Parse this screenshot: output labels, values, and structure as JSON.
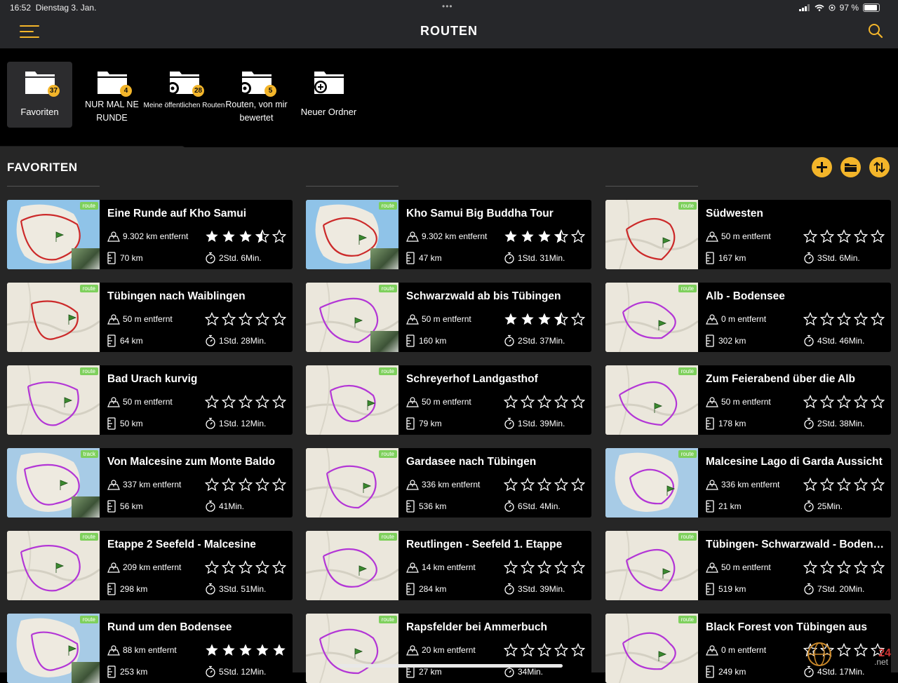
{
  "status_bar": {
    "time": "16:52",
    "date": "Dienstag 3. Jan.",
    "dots": "•••",
    "battery": "97 %"
  },
  "nav": {
    "title": "ROUTEN",
    "menu_icon": "hamburger-menu-icon",
    "search_icon": "search-icon"
  },
  "folders": [
    {
      "label": "Favoriten",
      "badge": "37",
      "icon": "folder-icon",
      "active": true
    },
    {
      "label": "NUR MAL NE RUNDE",
      "badge": "4",
      "icon": "folder-icon"
    },
    {
      "label": "Meine öffentlichen Routen",
      "badge": "28",
      "icon": "folder-gear-icon"
    },
    {
      "label": "Routen, von mir bewertet",
      "badge": "5",
      "icon": "folder-gear-icon"
    },
    {
      "label": "Neuer Ordner",
      "badge": "",
      "icon": "folder-add-icon"
    }
  ],
  "section": {
    "title": "FAVORITEN",
    "add_icon": "add-icon",
    "folder_icon": "folder-icon",
    "sort_icon": "sort-icon"
  },
  "colors": {
    "accent": "#f3b52a",
    "route_line": "#cc2a2a",
    "route_purple": "#b336d6",
    "tag_green": "#7ed05c"
  },
  "routes": [
    {
      "title": "Eine Runde auf Kho Samui",
      "distance": "9.302 km entfernt",
      "length": "70 km",
      "duration": "2Std. 6Min.",
      "rating": 3.5,
      "tag": "route"
    },
    {
      "title": "Kho Samui Big Buddha Tour",
      "distance": "9.302 km entfernt",
      "length": "47 km",
      "duration": "1Std. 31Min.",
      "rating": 3.5,
      "tag": "route"
    },
    {
      "title": "Südwesten",
      "distance": "50 m entfernt",
      "length": "167 km",
      "duration": "3Std. 6Min.",
      "rating": 0,
      "tag": "route"
    },
    {
      "title": "Tübingen nach Waiblingen",
      "distance": "50 m entfernt",
      "length": "64 km",
      "duration": "1Std. 28Min.",
      "rating": 0,
      "tag": "route"
    },
    {
      "title": "Schwarzwald ab bis Tübingen",
      "distance": "50 m entfernt",
      "length": "160 km",
      "duration": "2Std. 37Min.",
      "rating": 3.5,
      "tag": "route"
    },
    {
      "title": "Alb - Bodensee",
      "distance": "0 m entfernt",
      "length": "302 km",
      "duration": "4Std. 46Min.",
      "rating": 0,
      "tag": "route"
    },
    {
      "title": "Bad Urach kurvig",
      "distance": "50 m entfernt",
      "length": "50 km",
      "duration": "1Std. 12Min.",
      "rating": 0,
      "tag": "route"
    },
    {
      "title": "Schreyerhof Landgasthof",
      "distance": "50 m entfernt",
      "length": "79 km",
      "duration": "1Std. 39Min.",
      "rating": 0,
      "tag": "route"
    },
    {
      "title": "Zum Feierabend über die Alb",
      "distance": "50 m entfernt",
      "length": "178 km",
      "duration": "2Std. 38Min.",
      "rating": 0,
      "tag": "route"
    },
    {
      "title": "Von Malcesine zum Monte  Baldo",
      "distance": "337 km entfernt",
      "length": "56 km",
      "duration": "41Min.",
      "rating": 0,
      "tag": "track"
    },
    {
      "title": "Gardasee nach Tübingen",
      "distance": "336 km entfernt",
      "length": "536 km",
      "duration": "6Std. 4Min.",
      "rating": 0,
      "tag": "route"
    },
    {
      "title": "Malcesine Lago di Garda Aussicht",
      "distance": "336 km entfernt",
      "length": "21 km",
      "duration": "25Min.",
      "rating": 0,
      "tag": "route"
    },
    {
      "title": "Etappe 2 Seefeld - Malcesine",
      "distance": "209 km entfernt",
      "length": "298 km",
      "duration": "3Std. 51Min.",
      "rating": 0,
      "tag": "route"
    },
    {
      "title": "Reutlingen - Seefeld 1. Etappe",
      "distance": "14 km entfernt",
      "length": "284 km",
      "duration": "3Std. 39Min.",
      "rating": 0,
      "tag": "route"
    },
    {
      "title": "Tübingen- Schwarzwald - Bodensee - A...",
      "distance": "50 m entfernt",
      "length": "519 km",
      "duration": "7Std. 20Min.",
      "rating": 0,
      "tag": "route"
    },
    {
      "title": "Rund um den Bodensee",
      "distance": "88 km entfernt",
      "length": "253 km",
      "duration": "5Std. 12Min.",
      "rating": 5,
      "tag": "route"
    },
    {
      "title": "Rapsfelder bei Ammerbuch",
      "distance": "20 km entfernt",
      "length": "27 km",
      "duration": "34Min.",
      "rating": 0,
      "tag": "route"
    },
    {
      "title": "Black Forest von Tübingen aus",
      "distance": "0 m entfernt",
      "length": "249 km",
      "duration": "4Std. 17Min.",
      "rating": 0,
      "tag": "route"
    }
  ],
  "watermark": {
    "text": "24",
    "suffix": ".net"
  }
}
